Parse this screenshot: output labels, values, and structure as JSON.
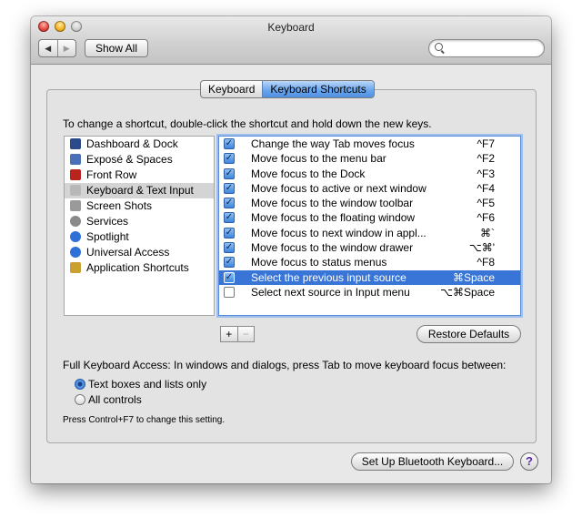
{
  "window": {
    "title": "Keyboard"
  },
  "toolbar": {
    "back_glyph": "◀",
    "forward_glyph": "▶",
    "show_all": "Show All",
    "search_placeholder": ""
  },
  "tabs": [
    {
      "label": "Keyboard",
      "active": false
    },
    {
      "label": "Keyboard Shortcuts",
      "active": true
    }
  ],
  "instruction": "To change a shortcut, double-click the shortcut and hold down the new keys.",
  "categories": [
    {
      "label": "Dashboard & Dock",
      "icon": "dashboard-icon",
      "color": "#2a4a8a",
      "selected": false
    },
    {
      "label": "Exposé & Spaces",
      "icon": "expose-icon",
      "color": "#4a70b8",
      "selected": false
    },
    {
      "label": "Front Row",
      "icon": "front-row-icon",
      "color": "#b8241c",
      "selected": false
    },
    {
      "label": "Keyboard & Text Input",
      "icon": "keyboard-icon",
      "color": "#b8b8b8",
      "selected": true
    },
    {
      "label": "Screen Shots",
      "icon": "camera-icon",
      "color": "#9a9a9a",
      "selected": false
    },
    {
      "label": "Services",
      "icon": "gear-icon",
      "color": "#8a8a8a",
      "selected": false
    },
    {
      "label": "Spotlight",
      "icon": "spotlight-icon",
      "color": "#2e6fd8",
      "selected": false
    },
    {
      "label": "Universal Access",
      "icon": "universal-access-icon",
      "color": "#2e6fd8",
      "selected": false
    },
    {
      "label": "Application Shortcuts",
      "icon": "app-shortcuts-icon",
      "color": "#caa030",
      "selected": false
    }
  ],
  "shortcuts": [
    {
      "checked": true,
      "name": "Change the way Tab moves focus",
      "key": "^F7",
      "selected": false
    },
    {
      "checked": true,
      "name": "Move focus to the menu bar",
      "key": "^F2",
      "selected": false
    },
    {
      "checked": true,
      "name": "Move focus to the Dock",
      "key": "^F3",
      "selected": false
    },
    {
      "checked": true,
      "name": "Move focus to active or next window",
      "key": "^F4",
      "selected": false
    },
    {
      "checked": true,
      "name": "Move focus to the window toolbar",
      "key": "^F5",
      "selected": false
    },
    {
      "checked": true,
      "name": "Move focus to the floating window",
      "key": "^F6",
      "selected": false
    },
    {
      "checked": true,
      "name": "Move focus to next window in appl...",
      "key": "⌘`",
      "selected": false
    },
    {
      "checked": true,
      "name": "Move focus to the window drawer",
      "key": "⌥⌘'",
      "selected": false
    },
    {
      "checked": true,
      "name": "Move focus to status menus",
      "key": "^F8",
      "selected": false
    },
    {
      "checked": true,
      "name": "Select the previous input source",
      "key": "⌘Space",
      "selected": true
    },
    {
      "checked": false,
      "name": "Select next source in Input menu",
      "key": "⌥⌘Space",
      "selected": false
    }
  ],
  "list_controls": {
    "plus": "+",
    "minus": "−"
  },
  "restore_defaults": "Restore Defaults",
  "full_keyboard_access": {
    "label": "Full Keyboard Access: In windows and dialogs, press Tab to move keyboard focus between:",
    "options": [
      {
        "label": "Text boxes and lists only",
        "selected": true
      },
      {
        "label": "All controls",
        "selected": false
      }
    ],
    "note": "Press Control+F7 to change this setting."
  },
  "bluetooth_button": "Set Up Bluetooth Keyboard...",
  "help_glyph": "?",
  "colors": {
    "selection": "#3875d7",
    "accent": "#4f8fe0"
  }
}
